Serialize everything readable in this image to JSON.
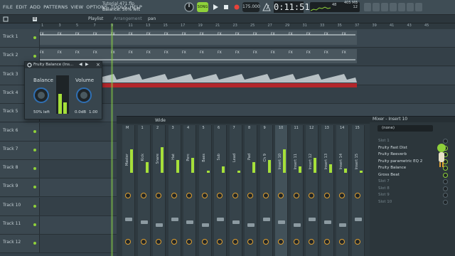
{
  "menu": [
    "FILE",
    "EDIT",
    "ADD",
    "PATTERNS",
    "VIEW",
    "OPTIONS",
    "TOOLS",
    "HELP"
  ],
  "project": {
    "file": "Tutorial 471.flp",
    "hint": "Balance: 50% left"
  },
  "transport": {
    "mode": "SONG",
    "tempo": "175.000",
    "time": "0:11:51",
    "cpu_value": "48",
    "mem_value": "405 MB",
    "mem_sub": "12"
  },
  "playlist": {
    "title": "Playlist",
    "crumb": "Arrangement",
    "pattern": "pan"
  },
  "ruler": [
    "1",
    "3",
    "5",
    "7",
    "9",
    "11",
    "13",
    "15",
    "17",
    "19",
    "21",
    "23",
    "25",
    "27",
    "29",
    "31",
    "33",
    "35",
    "37",
    "39",
    "41",
    "43",
    "45"
  ],
  "tracks": [
    "Track 1",
    "Track 2",
    "Track 3",
    "Track 4",
    "Track 5",
    "Track 6",
    "Track 7",
    "Track 8",
    "Track 9",
    "Track 10",
    "Track 11",
    "Track 12"
  ],
  "fx_label": "FX",
  "balance_plugin": {
    "title": "Fruity Balance (Ins...",
    "balance_label": "Balance",
    "volume_label": "Volume",
    "balance_value": "50% left",
    "volume_db": "0.0dB",
    "volume_value": "1.00",
    "balance": -0.5,
    "volume": 1.0
  },
  "mixer": {
    "view": "Wide",
    "title": "Mixer - Insert 10",
    "preset": "(none)",
    "strip_names": [
      "Master",
      "Kick",
      "Snare",
      "Hat",
      "Perc",
      "Bass",
      "Sub",
      "Lead",
      "Pad",
      "Ch 9",
      "Insert 10",
      "Insert 11",
      "Insert 12",
      "Insert 13",
      "Insert 14",
      "Insert 15"
    ],
    "strip_numbers": [
      "M",
      "1",
      "2",
      "3",
      "4",
      "5",
      "6",
      "7",
      "8",
      "9",
      "10",
      "11",
      "12",
      "13",
      "14",
      "15"
    ],
    "meter_levels": [
      0.55,
      0.25,
      0.6,
      0.3,
      0.35,
      0.05,
      0.15,
      0.05,
      0.25,
      0.3,
      0.55,
      0.15,
      0.35,
      0.2,
      0.1,
      0.05
    ],
    "slots": [
      {
        "name": "Slot 1",
        "active": false
      },
      {
        "name": "Fruity Fast Dist",
        "active": true
      },
      {
        "name": "Fruity Reeverb",
        "active": true
      },
      {
        "name": "Fruity parametric EQ 2",
        "active": true
      },
      {
        "name": "Fruity Balance",
        "active": true
      },
      {
        "name": "Gross Beat",
        "active": true
      },
      {
        "name": "Slot 7",
        "active": false
      },
      {
        "name": "Slot 8",
        "active": false
      },
      {
        "name": "Slot 9",
        "active": false
      },
      {
        "name": "Slot 10",
        "active": false
      }
    ]
  },
  "colors": {
    "accent": "#8fd13a",
    "meter": "#a6e03a",
    "clip_red": "#b3262b",
    "wave": "#b7c0c4",
    "knob_ring": "#2f6fb3"
  }
}
